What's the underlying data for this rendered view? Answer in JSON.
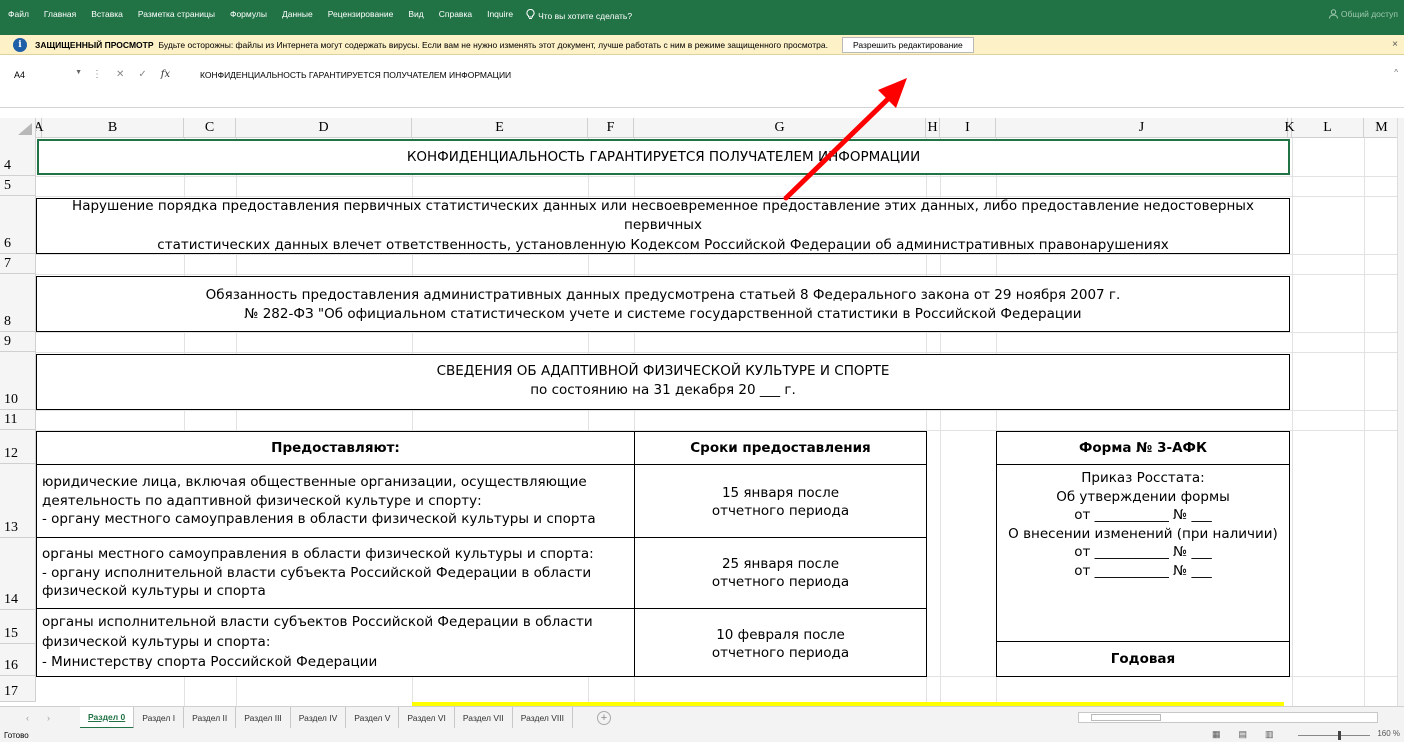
{
  "ribbon": {
    "tabs": [
      "Файл",
      "Главная",
      "Вставка",
      "Разметка страницы",
      "Формулы",
      "Данные",
      "Рецензирование",
      "Вид",
      "Справка",
      "Inquire"
    ],
    "tell_me": "Что вы хотите сделать?",
    "share": "Общий доступ"
  },
  "protected_view": {
    "title": "ЗАЩИЩЕННЫЙ ПРОСМОТР",
    "message": "Будьте осторожны: файлы из Интернета могут содержать вирусы. Если вам не нужно изменять этот документ, лучше работать с ним в режиме защищенного просмотра.",
    "enable_button": "Разрешить редактирование",
    "close": "×"
  },
  "formula_bar": {
    "name_box": "A4",
    "content": "КОНФИДЕНЦИАЛЬНОСТЬ ГАРАНТИРУЕТСЯ ПОЛУЧАТЕЛЕМ ИНФОРМАЦИИ"
  },
  "columns": [
    "A",
    "B",
    "C",
    "D",
    "E",
    "F",
    "G",
    "H",
    "I",
    "J",
    "K",
    "L",
    "M"
  ],
  "rows": [
    "4",
    "5",
    "6",
    "7",
    "8",
    "9",
    "10",
    "11",
    "12",
    "13",
    "14",
    "15",
    "16",
    "17"
  ],
  "cells": {
    "r4": "КОНФИДЕНЦИАЛЬНОСТЬ ГАРАНТИРУЕТСЯ ПОЛУЧАТЕЛЕМ ИНФОРМАЦИИ",
    "r6_l1": "Нарушение порядка предоставления первичных статистических данных или несвоевременное предоставление этих данных, либо предоставление недостоверных",
    "r6_l2": "первичных",
    "r6_l3": "статистических данных влечет ответственность, установленную Кодексом Российской Федерации об административных правонарушениях",
    "r8_l1": "Обязанность предоставления административных данных предусмотрена статьей 8 Федерального закона от 29 ноября 2007 г.",
    "r8_l2": "№ 282-ФЗ \"Об официальном статистическом учете и системе государственной статистики в Российской Федерации",
    "r10_l1": "СВЕДЕНИЯ ОБ АДАПТИВНОЙ ФИЗИЧЕСКОЙ КУЛЬТУРЕ И СПОРТЕ",
    "r10_l2": "по состоянию на 31 декабря 20 ___ г.",
    "hdr_provide": "Предоставляют:",
    "hdr_terms": "Сроки предоставления",
    "hdr_form": "Форма № 3-АФК",
    "p1_l1": "юридические лица, включая общественные организации, осуществляющие",
    "p1_l2": "деятельность по адаптивной физической культуре и спорту:",
    "p1_l3": "- органу местного самоуправления в области физической культуры и спорта",
    "t1_l1": "15 января после",
    "t1_l2": "отчетного периода",
    "p2_l1": "органы местного самоуправления в области физической культуры и спорта:",
    "p2_l2": "- органу исполнительной власти субъекта Российской Федерации в области",
    "p2_l3": "физической культуры и спорта",
    "t2_l1": "25 января после",
    "t2_l2": "отчетного периода",
    "p3_l1": "органы исполнительной власти субъектов Российской Федерации в области",
    "p3_l2": "физической культуры и спорта:",
    "p3_l3": "- Министерству спорта Российской Федерации",
    "t3_l1": "10 февраля после",
    "t3_l2": "отчетного периода",
    "f_l1": "Приказ Росстата:",
    "f_l2": "Об утверждении формы",
    "f_l3": "от ___________ № ___",
    "f_l4": "О внесении изменений (при наличии)",
    "f_l5": "от ___________ № ___",
    "f_l6": "от ___________ № ___",
    "annual": "Годовая"
  },
  "sheets": [
    "Раздел 0",
    "Раздел I",
    "Раздел II",
    "Раздел III",
    "Раздел IV",
    "Раздел V",
    "Раздел VI",
    "Раздел VII",
    "Раздел VIII"
  ],
  "status": {
    "ready": "Готово",
    "zoom": "160 %"
  },
  "colors": {
    "ribbon": "#217346",
    "protected_bar": "#fdf1c7",
    "arrow": "#ff0000",
    "highlight": "#ffff00"
  }
}
